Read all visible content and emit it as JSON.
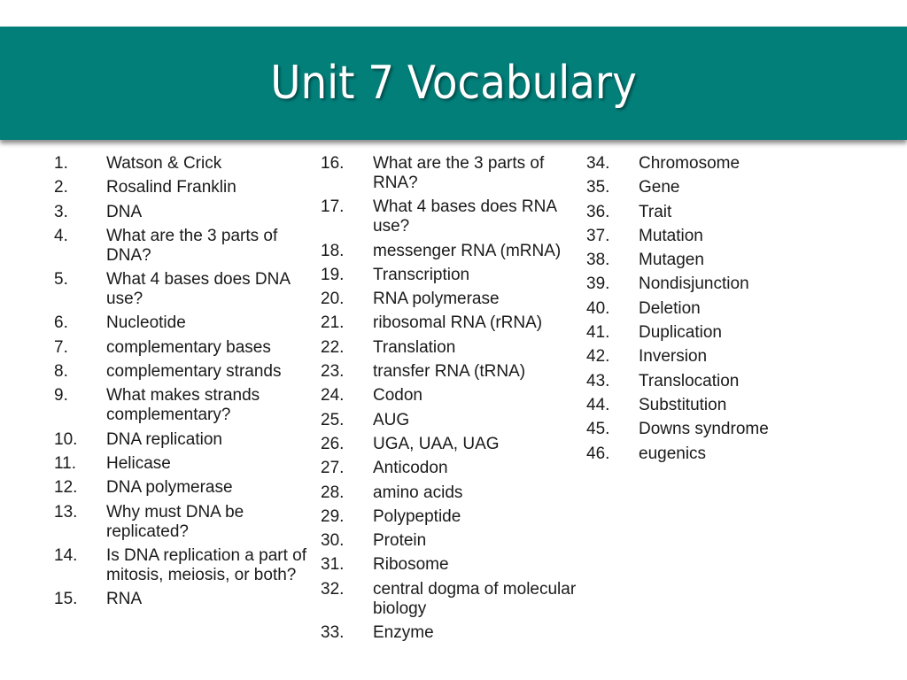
{
  "slide": {
    "title": "Unit 7 Vocabulary",
    "colors": {
      "banner": "#037f7a",
      "title_text": "#ffffff",
      "body_text": "#1a1a1a"
    }
  },
  "columns": [
    {
      "items": [
        {
          "num": "1.",
          "text": "Watson & Crick"
        },
        {
          "num": "2.",
          "text": "Rosalind Franklin"
        },
        {
          "num": "3.",
          "text": "DNA"
        },
        {
          "num": "4.",
          "text": "What are the 3 parts of DNA?"
        },
        {
          "num": "5.",
          "text": "What 4 bases does DNA use?"
        },
        {
          "num": "6.",
          "text": "Nucleotide"
        },
        {
          "num": "7.",
          "text": "complementary bases"
        },
        {
          "num": "8.",
          "text": "complementary strands"
        },
        {
          "num": "9.",
          "text": "What makes strands complementary?"
        },
        {
          "num": "10.",
          "text": "DNA replication"
        },
        {
          "num": "11.",
          "text": "Helicase"
        },
        {
          "num": "12.",
          "text": "DNA polymerase"
        },
        {
          "num": "13.",
          "text": "Why must DNA be replicated?"
        },
        {
          "num": "14.",
          "text": "Is DNA replication a part of mitosis, meiosis, or both?"
        },
        {
          "num": "15.",
          "text": "RNA"
        }
      ]
    },
    {
      "items": [
        {
          "num": "16.",
          "text": "What are the 3 parts of RNA?"
        },
        {
          "num": "17.",
          "text": "What 4 bases does RNA use?"
        },
        {
          "num": "18.",
          "text": "messenger RNA (mRNA)"
        },
        {
          "num": "19.",
          "text": "Transcription"
        },
        {
          "num": "20.",
          "text": "RNA polymerase"
        },
        {
          "num": "21.",
          "text": "ribosomal RNA (rRNA)"
        },
        {
          "num": "22.",
          "text": "Translation"
        },
        {
          "num": "23.",
          "text": "transfer RNA (tRNA)"
        },
        {
          "num": "24.",
          "text": "Codon"
        },
        {
          "num": "25.",
          "text": "AUG"
        },
        {
          "num": "26.",
          "text": "UGA, UAA, UAG"
        },
        {
          "num": "27.",
          "text": "Anticodon"
        },
        {
          "num": "28.",
          "text": "amino acids"
        },
        {
          "num": "29.",
          "text": "Polypeptide"
        },
        {
          "num": "30.",
          "text": "Protein"
        },
        {
          "num": "31.",
          "text": "Ribosome"
        },
        {
          "num": "32.",
          "text": "central dogma of molecular biology"
        },
        {
          "num": "33.",
          "text": "Enzyme"
        }
      ]
    },
    {
      "items": [
        {
          "num": "34.",
          "text": "Chromosome"
        },
        {
          "num": "35.",
          "text": "Gene"
        },
        {
          "num": "36.",
          "text": "Trait"
        },
        {
          "num": "37.",
          "text": "Mutation"
        },
        {
          "num": "38.",
          "text": "Mutagen"
        },
        {
          "num": "39.",
          "text": "Nondisjunction"
        },
        {
          "num": "40.",
          "text": "Deletion"
        },
        {
          "num": "41.",
          "text": "Duplication"
        },
        {
          "num": "42.",
          "text": "Inversion"
        },
        {
          "num": "43.",
          "text": "Translocation"
        },
        {
          "num": "44.",
          "text": "Substitution"
        },
        {
          "num": "45.",
          "text": "Downs syndrome"
        },
        {
          "num": "46.",
          "text": "eugenics"
        }
      ]
    }
  ]
}
